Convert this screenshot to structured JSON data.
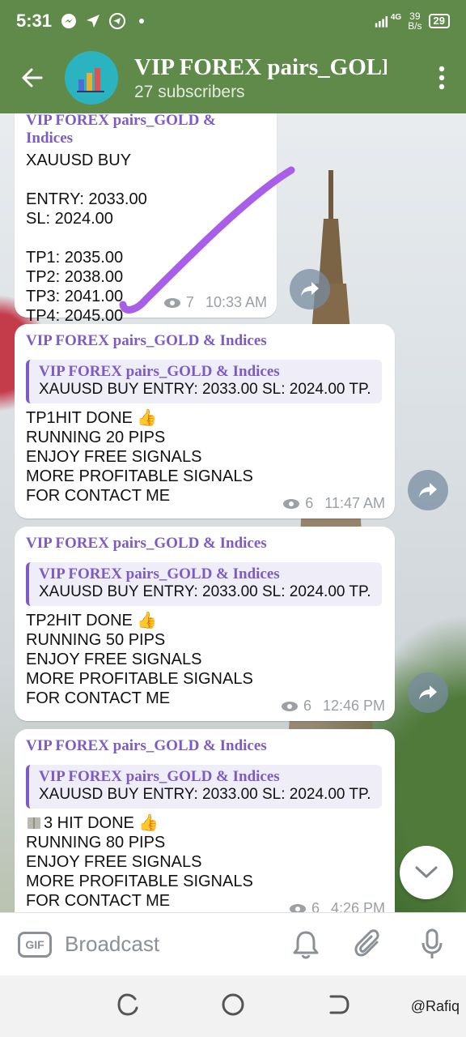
{
  "status_bar": {
    "time": "5:31",
    "network_type": "4G",
    "speed": "39",
    "speed_unit": "B/s",
    "battery": "29",
    "icons": [
      "messenger-icon",
      "navigation-icon",
      "telegram-icon",
      "dot-icon",
      "signal-icon",
      "battery-icon"
    ]
  },
  "header": {
    "title": "VIP FOREX pairs_GOLD",
    "subscribers": "27 subscribers",
    "colors": {
      "bar": "#5f8a4a",
      "avatar": "#2bb3c0"
    }
  },
  "messages": [
    {
      "sender": "VIP FOREX pairs_GOLD & Indices",
      "lines": [
        "XAUUSD BUY",
        "",
        "ENTRY: 2033.00",
        "SL: 2024.00",
        "",
        "TP1: 2035.00",
        "TP2: 2038.00",
        "TP3: 2041.00",
        "TP4: 2045.00"
      ],
      "views": "7",
      "time": "10:33 AM"
    },
    {
      "sender": "VIP FOREX pairs_GOLD & Indices",
      "quote_title": "VIP FOREX pairs_GOLD & Indices",
      "quote_text": "XAUUSD BUY  ENTRY: 2033.00 SL: 2024.00  TP...",
      "lines": [
        "TP1HIT DONE 👍",
        "RUNNING 20 PIPS",
        "ENJOY FREE SIGNALS",
        "MORE PROFITABLE SIGNALS",
        "FOR CONTACT ME"
      ],
      "views": "6",
      "time": "11:47 AM"
    },
    {
      "sender": "VIP FOREX pairs_GOLD & Indices",
      "quote_title": "VIP FOREX pairs_GOLD & Indices",
      "quote_text": "XAUUSD BUY  ENTRY: 2033.00 SL: 2024.00  TP...",
      "lines": [
        "TP2HIT DONE 👍",
        "RUNNING 50 PIPS",
        "ENJOY FREE SIGNALS",
        "MORE PROFITABLE SIGNALS",
        "FOR CONTACT ME"
      ],
      "views": "6",
      "time": "12:46 PM"
    },
    {
      "sender": "VIP FOREX pairs_GOLD & Indices",
      "quote_title": "VIP FOREX pairs_GOLD & Indices",
      "quote_text": "XAUUSD BUY  ENTRY: 2033.00 SL: 2024.00  TP...",
      "lines": [
        "3 HIT DONE 👍",
        "RUNNING 80 PIPS",
        "ENJOY FREE SIGNALS",
        "MORE PROFITABLE SIGNALS",
        "FOR CONTACT ME"
      ],
      "views": "6",
      "time": "4:26 PM"
    }
  ],
  "input": {
    "gif_label": "GIF",
    "placeholder": "Broadcast"
  },
  "watermark": "@Rafiq",
  "accent_color": "#7c5cc4"
}
